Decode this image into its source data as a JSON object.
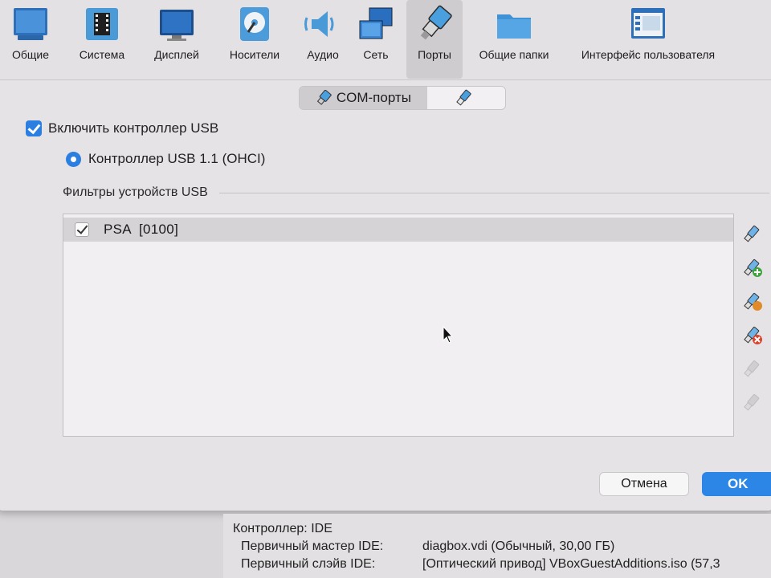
{
  "toolbar": {
    "items": [
      {
        "label": "Общие",
        "icon": "general-icon"
      },
      {
        "label": "Система",
        "icon": "system-chip-icon"
      },
      {
        "label": "Дисплей",
        "icon": "display-icon"
      },
      {
        "label": "Носители",
        "icon": "storage-disk-icon"
      },
      {
        "label": "Аудио",
        "icon": "audio-speaker-icon"
      },
      {
        "label": "Сеть",
        "icon": "network-icon"
      },
      {
        "label": "Порты",
        "icon": "ports-icon",
        "active": true
      },
      {
        "label": "Общие папки",
        "icon": "shared-folder-icon"
      },
      {
        "label": "Интерфейс пользователя",
        "icon": "user-interface-icon"
      }
    ]
  },
  "tabs": {
    "com_ports": "COM-порты",
    "usb": ""
  },
  "usb": {
    "enable_label": "Включить контроллер USB",
    "enabled": true,
    "controller_label": "Контроллер USB 1.1 (OHCI)",
    "filters_title": "Фильтры устройств USB",
    "filters": [
      {
        "name": "PSA  [0100]",
        "checked": true
      }
    ]
  },
  "side_tools": [
    {
      "icon": "usb-filter-add-empty-icon",
      "enabled": true
    },
    {
      "icon": "usb-filter-add-device-icon",
      "enabled": true
    },
    {
      "icon": "usb-filter-edit-icon",
      "enabled": true
    },
    {
      "icon": "usb-filter-remove-icon",
      "enabled": true
    },
    {
      "icon": "usb-filter-move-up-icon",
      "enabled": false
    },
    {
      "icon": "usb-filter-move-down-icon",
      "enabled": false
    }
  ],
  "buttons": {
    "cancel": "Отмена",
    "ok": "OK"
  },
  "background_info": {
    "controller": "Контроллер: IDE",
    "primary_master_label": "Первичный мастер IDE:",
    "primary_master_value": "diagbox.vdi (Обычный, 30,00 ГБ)",
    "primary_slave_label": "Первичный слэйв IDE:",
    "primary_slave_value": "[Оптический привод] VBoxGuestAdditions.iso (57,3"
  },
  "colors": {
    "accent": "#2b86e6",
    "window_bg": "#e6e3e6"
  }
}
